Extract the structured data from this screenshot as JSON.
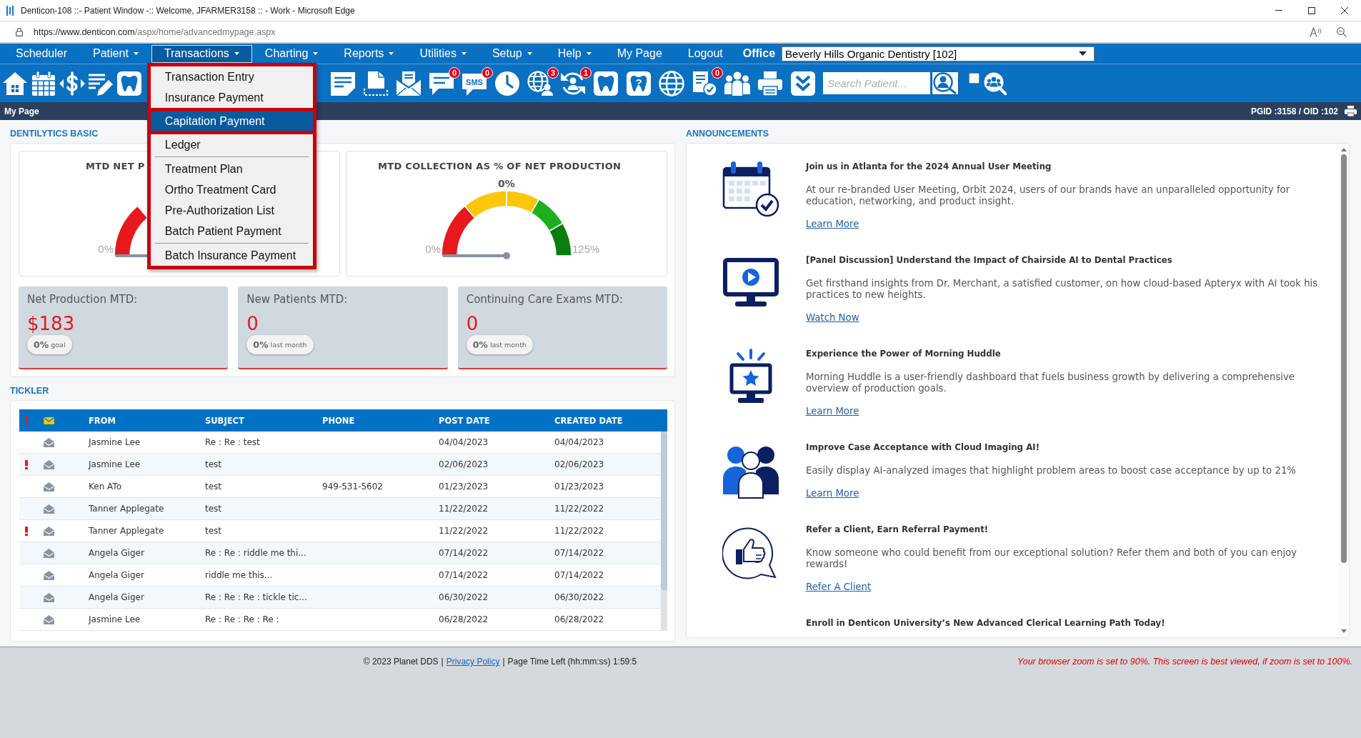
{
  "browser": {
    "title": "Denticon-108 ::- Patient Window -:: Welcome, JFARMER3158 :: - Work - Microsoft Edge",
    "url_origin": "https://www.denticon.com",
    "url_path": "/aspx/home/advancedmypage.aspx"
  },
  "nav": {
    "items": [
      {
        "label": "Scheduler",
        "dropdown": false,
        "selected": false
      },
      {
        "label": "Patient",
        "dropdown": true,
        "selected": false
      },
      {
        "label": "Transactions",
        "dropdown": true,
        "selected": true,
        "menu": [
          [
            {
              "label": "Transaction Entry",
              "selected": false
            },
            {
              "label": "Insurance Payment",
              "selected": false
            },
            {
              "label": "Capitation Payment",
              "selected": true
            },
            {
              "label": "Ledger",
              "selected": false
            }
          ],
          [
            {
              "label": "Treatment Plan",
              "selected": false
            },
            {
              "label": "Ortho Treatment Card",
              "selected": false
            },
            {
              "label": "Pre-Authorization List",
              "selected": false
            },
            {
              "label": "Batch Patient Payment",
              "selected": false
            }
          ],
          [
            {
              "label": "Batch Insurance Payment",
              "selected": false
            }
          ]
        ]
      },
      {
        "label": "Charting",
        "dropdown": true,
        "selected": false
      },
      {
        "label": "Reports",
        "dropdown": true,
        "selected": false
      },
      {
        "label": "Utilities",
        "dropdown": true,
        "selected": false
      },
      {
        "label": "Setup",
        "dropdown": true,
        "selected": false
      },
      {
        "label": "Help",
        "dropdown": true,
        "selected": false
      },
      {
        "label": "My Page",
        "dropdown": false,
        "selected": false
      },
      {
        "label": "Logout",
        "dropdown": false,
        "selected": false
      }
    ],
    "office_label": "Office",
    "office_value": "Beverly Hills Organic Dentistry [102]"
  },
  "toolbar": {
    "icon_groups": [
      [
        {
          "kind": "home"
        },
        {
          "kind": "calendar"
        },
        {
          "kind": "dollar"
        },
        {
          "kind": "edit"
        },
        {
          "kind": "tooth"
        }
      ],
      [
        {
          "kind": "note"
        },
        {
          "kind": "document"
        },
        {
          "kind": "mail"
        },
        {
          "kind": "chat",
          "badge": "0"
        },
        {
          "kind": "sms",
          "text": "SMS",
          "badge": "0"
        },
        {
          "kind": "clock"
        },
        {
          "kind": "globe-person",
          "badge": "3"
        },
        {
          "kind": "sync-person",
          "badge": "1"
        },
        {
          "kind": "tooth"
        },
        {
          "kind": "tooth",
          "text": "?"
        },
        {
          "kind": "globe"
        },
        {
          "kind": "checklist",
          "badge": "0"
        },
        {
          "kind": "people"
        },
        {
          "kind": "printer"
        },
        {
          "kind": "chevron"
        }
      ]
    ],
    "search": {
      "placeholder": "Search Patient..."
    },
    "checkbox": {
      "checked": false
    }
  },
  "page_bar": {
    "title": "My Page",
    "ids": "PGID :3158 / OID :102"
  },
  "dentilytics": {
    "heading": "DENTILYTICS BASIC",
    "gauges": [
      {
        "title": "MTD NET P",
        "min_label": "0%",
        "level": 0,
        "segments": [
          {
            "color": "#e8191c"
          }
        ]
      },
      {
        "title": "MTD COLLECTION AS % OF NET PRODUCTION",
        "value_label": "0%",
        "min_label": "0%",
        "max_label": "125%",
        "level": 0,
        "segments": [
          {
            "color": "#e8191c"
          },
          {
            "color": "#fcc60a"
          },
          {
            "color": "#fcc60a"
          },
          {
            "color": "#1fae1f"
          },
          {
            "color": "#0a7d10"
          }
        ]
      }
    ],
    "stats": [
      {
        "title": "Net Production MTD:",
        "value": "$183",
        "badge_value": "0%",
        "badge_label": "goal"
      },
      {
        "title": "New Patients MTD:",
        "value": "0",
        "badge_value": "0%",
        "badge_label": "last month"
      },
      {
        "title": "Continuing Care Exams MTD:",
        "value": "0",
        "badge_value": "0%",
        "badge_label": "last month"
      }
    ]
  },
  "tickler": {
    "heading": "TICKLER",
    "columns": [
      {
        "kind": "flag"
      },
      {
        "kind": "mail"
      },
      {
        "kind": "text",
        "label": "FROM"
      },
      {
        "kind": "text",
        "label": "SUBJECT"
      },
      {
        "kind": "text",
        "label": "PHONE"
      },
      {
        "kind": "text",
        "label": "POST DATE"
      },
      {
        "kind": "text",
        "label": "CREATED DATE"
      }
    ],
    "rows": [
      {
        "urgent": false,
        "from": "Jasmine Lee",
        "subject": "Re : Re : test",
        "post_date": "04/04/2023",
        "created_date": "04/04/2023"
      },
      {
        "urgent": true,
        "from": "Jasmine Lee",
        "subject": "test",
        "post_date": "02/06/2023",
        "created_date": "02/06/2023"
      },
      {
        "urgent": false,
        "from": "Ken ATo",
        "subject": "test",
        "phone": "949-531-5602",
        "post_date": "01/23/2023",
        "created_date": "01/23/2023"
      },
      {
        "urgent": false,
        "from": "Tanner Applegate",
        "subject": "test",
        "post_date": "11/22/2022",
        "created_date": "11/22/2022"
      },
      {
        "urgent": true,
        "from": "Tanner Applegate",
        "subject": "test",
        "post_date": "11/22/2022",
        "created_date": "11/22/2022"
      },
      {
        "urgent": false,
        "from": "Angela Giger",
        "subject": "Re : Re : riddle me thi...",
        "post_date": "07/14/2022",
        "created_date": "07/14/2022"
      },
      {
        "urgent": false,
        "from": "Angela Giger",
        "subject": "riddle me this...",
        "post_date": "07/14/2022",
        "created_date": "07/14/2022"
      },
      {
        "urgent": false,
        "from": "Angela Giger",
        "subject": "Re : Re : Re : tickle tic...",
        "post_date": "06/30/2022",
        "created_date": "06/30/2022"
      },
      {
        "urgent": false,
        "from": "Jasmine Lee",
        "subject": "Re : Re : Re : Re :",
        "post_date": "06/28/2022",
        "created_date": "06/28/2022"
      }
    ]
  },
  "announcements": {
    "heading": "ANNOUNCEMENTS",
    "items": [
      {
        "kind": "calendar-check",
        "title": "Join us in Atlanta for the 2024 Annual User Meeting",
        "body": "At our re-branded User Meeting, Orbit 2024, users of our brands have an unparalleled opportunity for education, networking, and product insight.",
        "link": "Learn More"
      },
      {
        "kind": "monitor-play",
        "title": "[Panel Discussion] Understand the Impact of Chairside AI to Dental Practices",
        "body": "Get firsthand insights from Dr. Merchant, a satisfied customer, on how cloud-based Apteryx with AI took his practices to new heights.",
        "link": "Watch Now"
      },
      {
        "kind": "monitor-star",
        "title": "Experience the Power of Morning Huddle",
        "body": "Morning Huddle is a user-friendly dashboard that fuels business growth by delivering a comprehensive overview of production goals.",
        "link": "Learn More"
      },
      {
        "kind": "people",
        "title": "Improve Case Acceptance with Cloud Imaging AI!",
        "body": "Easily display AI-analyzed images that highlight problem areas to boost case acceptance by up to 21%",
        "link": "Learn More"
      },
      {
        "kind": "thumbs-up",
        "title": "Refer a Client, Earn Referral Payment!",
        "body": "Know someone who could benefit from our exceptional solution? Refer them and both of you can enjoy rewards!",
        "link": "Refer A Client"
      },
      {
        "title": "Enroll in Denticon University’s New Advanced Clerical Learning Path Today!"
      }
    ]
  },
  "footer": {
    "parts": [
      {
        "kind": "text",
        "text": "© 2023 Planet DDS"
      },
      {
        "kind": "divider",
        "text": "|"
      },
      {
        "kind": "link",
        "text": "Privacy Policy"
      },
      {
        "kind": "divider",
        "text": "|"
      },
      {
        "kind": "text",
        "text": "Page Time Left (hh:mm:ss) 1:59:5"
      }
    ],
    "notice": "Your browser zoom is set to 90%. This screen is best viewed, if zoom is set to 100%."
  }
}
